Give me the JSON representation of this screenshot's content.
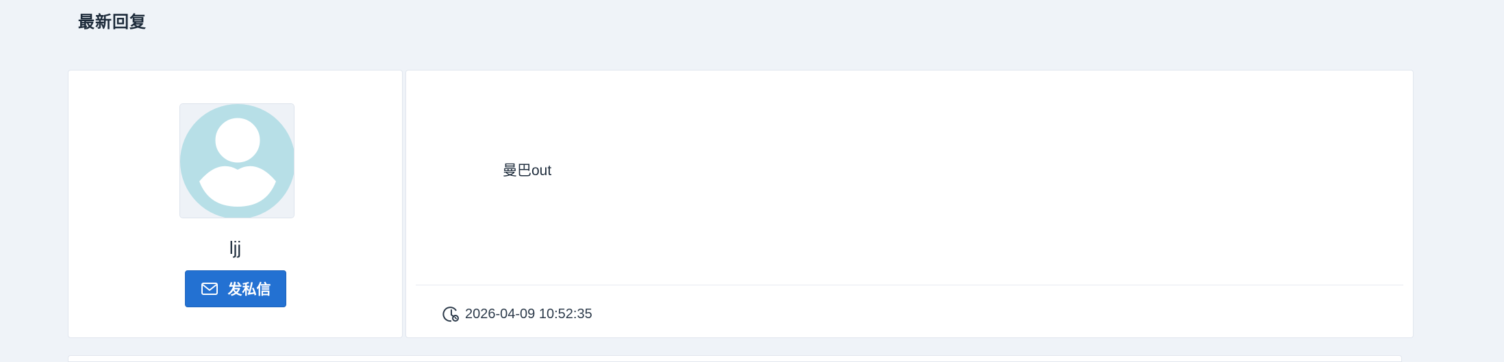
{
  "section": {
    "title": "最新回复"
  },
  "reply": {
    "user": {
      "username": "ljj",
      "avatar_icon": "default-user-avatar-icon",
      "message_button_label": "发私信",
      "message_button_icon": "mail-icon"
    },
    "content": "曼巴out",
    "timestamp": "2026-04-09 10:52:35",
    "timestamp_icon": "clock-icon"
  },
  "colors": {
    "page_background": "#eff3f8",
    "card_background": "#ffffff",
    "primary_button": "#2371d2",
    "avatar_silhouette": "#b7dfe7"
  }
}
